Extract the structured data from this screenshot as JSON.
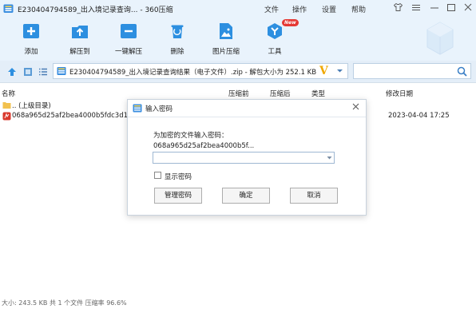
{
  "window": {
    "title": "E230404794589_出入境记录查询... - 360压缩",
    "menu": [
      "文件",
      "操作",
      "设置",
      "帮助"
    ]
  },
  "toolbar": {
    "items": [
      {
        "label": "添加",
        "icon": "add-icon"
      },
      {
        "label": "解压到",
        "icon": "extract-to-icon"
      },
      {
        "label": "一键解压",
        "icon": "one-click-extract-icon"
      },
      {
        "label": "删除",
        "icon": "delete-icon"
      },
      {
        "label": "图片压缩",
        "icon": "image-compress-icon"
      },
      {
        "label": "工具",
        "icon": "tools-icon"
      }
    ],
    "new_badge": "New"
  },
  "address": {
    "path": "E230404794589_出入境记录查询结果（电子文件）.zip - 解包大小为 252.1 KB",
    "search_placeholder": ""
  },
  "columns": {
    "name": "名称",
    "compressed_before": "压缩前",
    "compressed_after": "压缩后",
    "type": "类型",
    "modified": "修改日期"
  },
  "files": [
    {
      "name": ".. (上级目录)",
      "icon": "folder-icon",
      "date": ""
    },
    {
      "name": "068a965d25af2bea4000b5fdc3d17c",
      "icon": "pdf-file-icon",
      "date": "2023-04-04 17:25"
    }
  ],
  "status": "大小: 243.5 KB 共 1 个文件 压缩率 96.6%",
  "dialog": {
    "title": "输入密码",
    "prompt": "为加密的文件输入密码：",
    "filename": "068a965d25af2bea4000b5f...",
    "password_value": "",
    "show_password_label": "显示密码",
    "manage_button": "管理密码",
    "ok_button": "确定",
    "cancel_button": "取消"
  },
  "colors": {
    "chrome_bg": "#e9f3fc",
    "accent_blue": "#2d8fe0",
    "new_badge": "#e53935",
    "v_logo": "#f0a800"
  }
}
